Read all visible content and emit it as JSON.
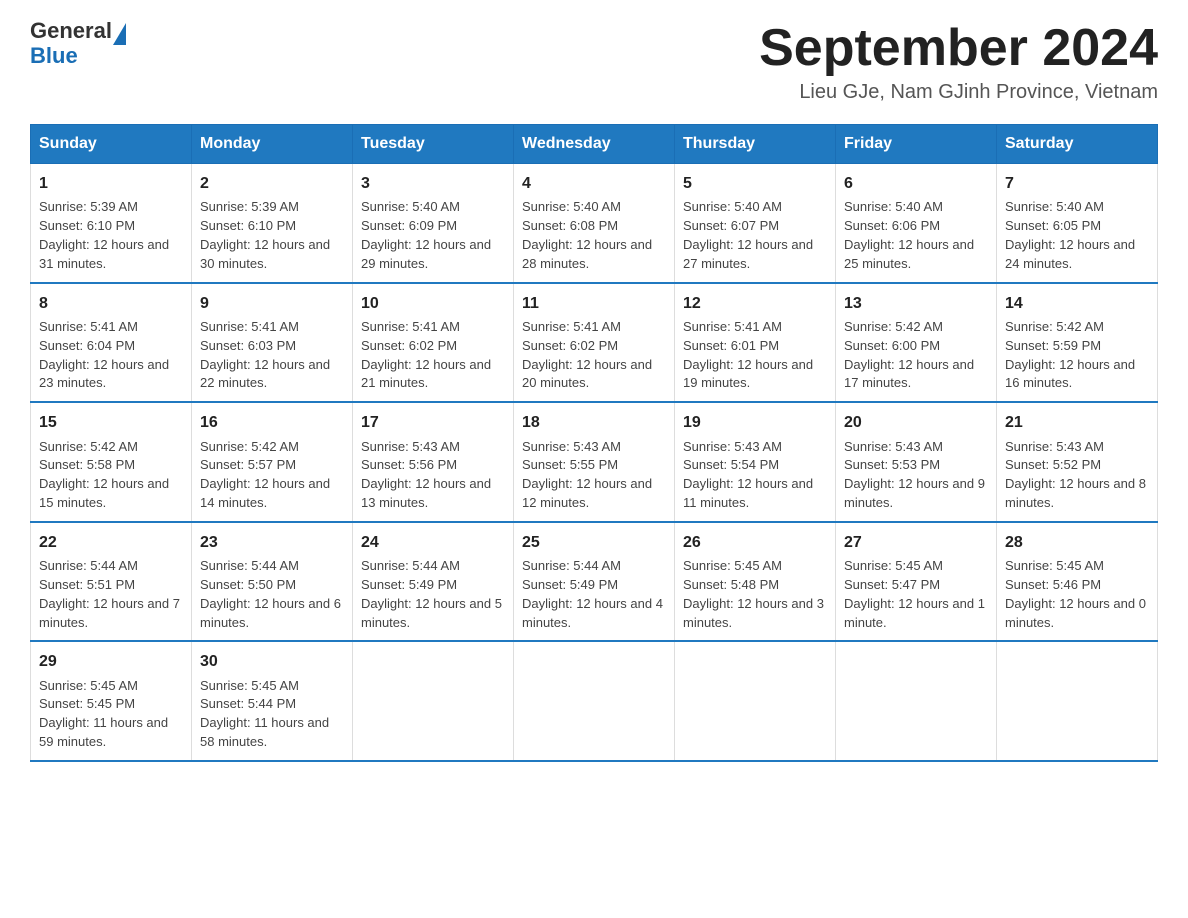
{
  "header": {
    "logo_general": "General",
    "logo_blue": "Blue",
    "month_title": "September 2024",
    "location": "Lieu GJe, Nam GJinh Province, Vietnam"
  },
  "weekdays": [
    "Sunday",
    "Monday",
    "Tuesday",
    "Wednesday",
    "Thursday",
    "Friday",
    "Saturday"
  ],
  "weeks": [
    [
      {
        "day": "1",
        "sunrise": "5:39 AM",
        "sunset": "6:10 PM",
        "daylight": "12 hours and 31 minutes."
      },
      {
        "day": "2",
        "sunrise": "5:39 AM",
        "sunset": "6:10 PM",
        "daylight": "12 hours and 30 minutes."
      },
      {
        "day": "3",
        "sunrise": "5:40 AM",
        "sunset": "6:09 PM",
        "daylight": "12 hours and 29 minutes."
      },
      {
        "day": "4",
        "sunrise": "5:40 AM",
        "sunset": "6:08 PM",
        "daylight": "12 hours and 28 minutes."
      },
      {
        "day": "5",
        "sunrise": "5:40 AM",
        "sunset": "6:07 PM",
        "daylight": "12 hours and 27 minutes."
      },
      {
        "day": "6",
        "sunrise": "5:40 AM",
        "sunset": "6:06 PM",
        "daylight": "12 hours and 25 minutes."
      },
      {
        "day": "7",
        "sunrise": "5:40 AM",
        "sunset": "6:05 PM",
        "daylight": "12 hours and 24 minutes."
      }
    ],
    [
      {
        "day": "8",
        "sunrise": "5:41 AM",
        "sunset": "6:04 PM",
        "daylight": "12 hours and 23 minutes."
      },
      {
        "day": "9",
        "sunrise": "5:41 AM",
        "sunset": "6:03 PM",
        "daylight": "12 hours and 22 minutes."
      },
      {
        "day": "10",
        "sunrise": "5:41 AM",
        "sunset": "6:02 PM",
        "daylight": "12 hours and 21 minutes."
      },
      {
        "day": "11",
        "sunrise": "5:41 AM",
        "sunset": "6:02 PM",
        "daylight": "12 hours and 20 minutes."
      },
      {
        "day": "12",
        "sunrise": "5:41 AM",
        "sunset": "6:01 PM",
        "daylight": "12 hours and 19 minutes."
      },
      {
        "day": "13",
        "sunrise": "5:42 AM",
        "sunset": "6:00 PM",
        "daylight": "12 hours and 17 minutes."
      },
      {
        "day": "14",
        "sunrise": "5:42 AM",
        "sunset": "5:59 PM",
        "daylight": "12 hours and 16 minutes."
      }
    ],
    [
      {
        "day": "15",
        "sunrise": "5:42 AM",
        "sunset": "5:58 PM",
        "daylight": "12 hours and 15 minutes."
      },
      {
        "day": "16",
        "sunrise": "5:42 AM",
        "sunset": "5:57 PM",
        "daylight": "12 hours and 14 minutes."
      },
      {
        "day": "17",
        "sunrise": "5:43 AM",
        "sunset": "5:56 PM",
        "daylight": "12 hours and 13 minutes."
      },
      {
        "day": "18",
        "sunrise": "5:43 AM",
        "sunset": "5:55 PM",
        "daylight": "12 hours and 12 minutes."
      },
      {
        "day": "19",
        "sunrise": "5:43 AM",
        "sunset": "5:54 PM",
        "daylight": "12 hours and 11 minutes."
      },
      {
        "day": "20",
        "sunrise": "5:43 AM",
        "sunset": "5:53 PM",
        "daylight": "12 hours and 9 minutes."
      },
      {
        "day": "21",
        "sunrise": "5:43 AM",
        "sunset": "5:52 PM",
        "daylight": "12 hours and 8 minutes."
      }
    ],
    [
      {
        "day": "22",
        "sunrise": "5:44 AM",
        "sunset": "5:51 PM",
        "daylight": "12 hours and 7 minutes."
      },
      {
        "day": "23",
        "sunrise": "5:44 AM",
        "sunset": "5:50 PM",
        "daylight": "12 hours and 6 minutes."
      },
      {
        "day": "24",
        "sunrise": "5:44 AM",
        "sunset": "5:49 PM",
        "daylight": "12 hours and 5 minutes."
      },
      {
        "day": "25",
        "sunrise": "5:44 AM",
        "sunset": "5:49 PM",
        "daylight": "12 hours and 4 minutes."
      },
      {
        "day": "26",
        "sunrise": "5:45 AM",
        "sunset": "5:48 PM",
        "daylight": "12 hours and 3 minutes."
      },
      {
        "day": "27",
        "sunrise": "5:45 AM",
        "sunset": "5:47 PM",
        "daylight": "12 hours and 1 minute."
      },
      {
        "day": "28",
        "sunrise": "5:45 AM",
        "sunset": "5:46 PM",
        "daylight": "12 hours and 0 minutes."
      }
    ],
    [
      {
        "day": "29",
        "sunrise": "5:45 AM",
        "sunset": "5:45 PM",
        "daylight": "11 hours and 59 minutes."
      },
      {
        "day": "30",
        "sunrise": "5:45 AM",
        "sunset": "5:44 PM",
        "daylight": "11 hours and 58 minutes."
      },
      null,
      null,
      null,
      null,
      null
    ]
  ]
}
